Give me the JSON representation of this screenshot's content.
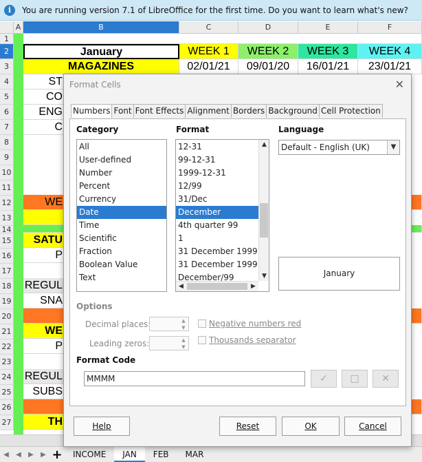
{
  "infobar": {
    "text": "You are running version 7.1 of LibreOffice for the first time. Do you want to learn what's new?"
  },
  "sheet": {
    "columns": [
      "A",
      "B",
      "C",
      "D",
      "E",
      "F"
    ],
    "rows": [
      "1",
      "2",
      "3",
      "4",
      "5",
      "6",
      "7",
      "8",
      "9",
      "10",
      "11",
      "12",
      "13",
      "14",
      "15",
      "16",
      "17",
      "18",
      "19",
      "20",
      "21",
      "22",
      "23",
      "24",
      "25",
      "26",
      "27"
    ],
    "cells": {
      "b2": "January",
      "c2": "WEEK 1",
      "d2": "WEEK 2",
      "e2": "WEEK 3",
      "f2": "WEEK 4",
      "b3": "MAGAZINES",
      "c3": "02/01/21",
      "d3": "09/01/20",
      "e3": "16/01/21",
      "f3": "23/01/21",
      "b4": "ST",
      "b5": "CO",
      "b6": "ENG",
      "b7": "C",
      "b12": "WE",
      "b15": "SATU",
      "b16": "P",
      "b18": "REGUL",
      "b19": "SNA",
      "b21": "WE",
      "b22": "P",
      "b24": "REGUL",
      "b25": "SUBS",
      "b27": "TH"
    },
    "colors": {
      "green": "#66ee55",
      "yellow": "#ffff00",
      "orange": "#ff7722",
      "lightgreen": "#8cf06a",
      "teal": "#2ee6a0",
      "cyan": "#5ef2f2",
      "grey": "#e6e6e6"
    }
  },
  "tabbar": {
    "sheets": [
      "INCOME",
      "JAN",
      "FEB",
      "MAR"
    ],
    "active": "JAN"
  },
  "dialog": {
    "title": "Format Cells",
    "tabs": [
      "Numbers",
      "Font",
      "Font Effects",
      "Alignment",
      "Borders",
      "Background",
      "Cell Protection"
    ],
    "category_label": "Category",
    "categories": [
      "All",
      "User-defined",
      "Number",
      "Percent",
      "Currency",
      "Date",
      "Time",
      "Scientific",
      "Fraction",
      "Boolean Value",
      "Text"
    ],
    "selected_category": "Date",
    "format_label": "Format",
    "formats": [
      "12-31",
      "99-12-31",
      "1999-12-31",
      "12/99",
      "31/Dec",
      "December",
      "4th quarter 99",
      "1",
      "31 December 1999",
      "31 December 1999",
      "December/99"
    ],
    "selected_format": "December",
    "language_label": "Language",
    "language_value": "Default - English (UK)",
    "preview": "January",
    "options_label": "Options",
    "decimal_places_label": "Decimal places:",
    "leading_zeros_label": "Leading zeros:",
    "negative_red_label": "Negative numbers red",
    "thousands_label": "Thousands separator",
    "format_code_label": "Format Code",
    "format_code_value": "MMMM",
    "buttons": {
      "help": "Help",
      "reset": "Reset",
      "ok": "OK",
      "cancel": "Cancel"
    }
  }
}
